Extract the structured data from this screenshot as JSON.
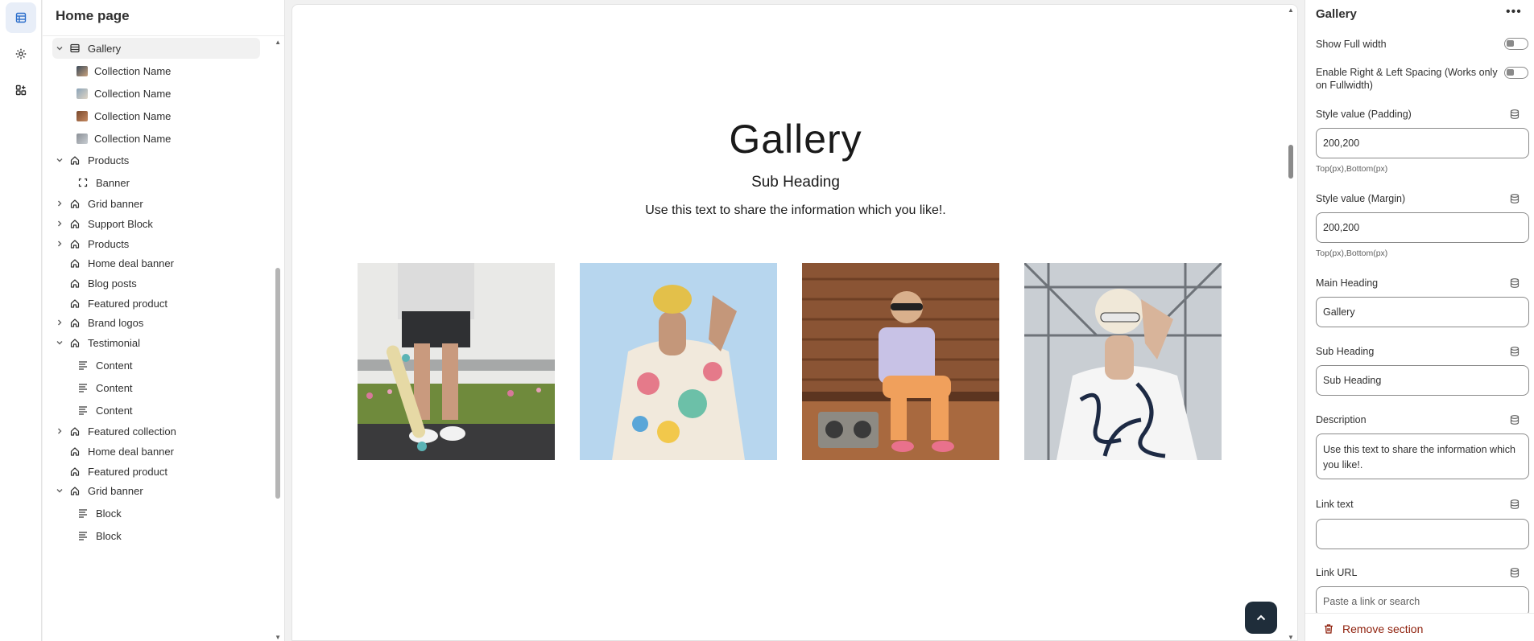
{
  "sidebar": {
    "title": "Home page",
    "items": [
      {
        "label": "Gallery",
        "icon": "section-grid-icon",
        "expand": "open",
        "indent": 0,
        "selected": true
      },
      {
        "label": "Collection Name",
        "icon": "thumb-1",
        "indent": 1
      },
      {
        "label": "Collection Name",
        "icon": "thumb-2",
        "indent": 1
      },
      {
        "label": "Collection Name",
        "icon": "thumb-3",
        "indent": 1
      },
      {
        "label": "Collection Name",
        "icon": "thumb-4",
        "indent": 1
      },
      {
        "label": "Products",
        "icon": "home-icon",
        "expand": "open",
        "indent": 0
      },
      {
        "label": "Banner",
        "icon": "banner-frame-icon",
        "indent": 1
      },
      {
        "label": "Grid banner",
        "icon": "home-icon",
        "expand": "closed",
        "indent": 0
      },
      {
        "label": "Support Block",
        "icon": "home-icon",
        "expand": "closed",
        "indent": 0
      },
      {
        "label": "Products",
        "icon": "home-icon",
        "expand": "closed",
        "indent": 0
      },
      {
        "label": "Home deal banner",
        "icon": "home-icon",
        "indent": 0
      },
      {
        "label": "Blog posts",
        "icon": "home-icon",
        "indent": 0
      },
      {
        "label": "Featured product",
        "icon": "home-icon",
        "indent": 0
      },
      {
        "label": "Brand logos",
        "icon": "home-icon",
        "expand": "closed",
        "indent": 0
      },
      {
        "label": "Testimonial",
        "icon": "home-icon",
        "expand": "open",
        "indent": 0
      },
      {
        "label": "Content",
        "icon": "text-lines-icon",
        "indent": 1
      },
      {
        "label": "Content",
        "icon": "text-lines-icon",
        "indent": 1
      },
      {
        "label": "Content",
        "icon": "text-lines-icon",
        "indent": 1
      },
      {
        "label": "Featured collection",
        "icon": "home-icon",
        "expand": "closed",
        "indent": 0
      },
      {
        "label": "Home deal banner",
        "icon": "home-icon",
        "indent": 0
      },
      {
        "label": "Featured product",
        "icon": "home-icon",
        "indent": 0
      },
      {
        "label": "Grid banner",
        "icon": "home-icon",
        "expand": "open",
        "indent": 0
      },
      {
        "label": "Block",
        "icon": "text-lines-icon",
        "indent": 1
      },
      {
        "label": "Block",
        "icon": "text-lines-icon",
        "indent": 1
      }
    ]
  },
  "canvas": {
    "title": "Gallery",
    "subheading": "Sub Heading",
    "description": "Use this text to share the information which you like!."
  },
  "settings": {
    "title": "Gallery",
    "show_full_width_label": "Show Full width",
    "spacing_label": "Enable Right & Left Spacing (Works only on Fullwidth)",
    "padding_label": "Style value (Padding)",
    "padding_value": "200,200",
    "padding_help": "Top(px),Bottom(px)",
    "margin_label": "Style value (Margin)",
    "margin_value": "200,200",
    "margin_help": "Top(px),Bottom(px)",
    "main_heading_label": "Main Heading",
    "main_heading_value": "Gallery",
    "sub_heading_label": "Sub Heading",
    "sub_heading_value": "Sub Heading",
    "description_label": "Description",
    "description_value": "Use this text to share the information which you like!.",
    "link_text_label": "Link text",
    "link_text_value": "",
    "link_url_label": "Link URL",
    "link_url_placeholder": "Paste a link or search",
    "remove_label": "Remove section"
  },
  "colors": {
    "accent": "#1f2d3a",
    "danger": "#8e1f0b",
    "rail_active": "#e8eef8"
  }
}
